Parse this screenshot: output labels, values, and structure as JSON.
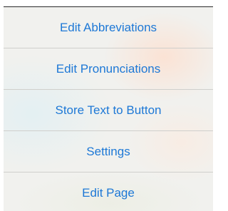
{
  "menu": {
    "items": [
      {
        "label": "Edit Abbreviations"
      },
      {
        "label": "Edit Pronunciations"
      },
      {
        "label": "Store Text to Button"
      },
      {
        "label": "Settings"
      },
      {
        "label": "Edit Page"
      }
    ]
  },
  "colors": {
    "accent": "#1d78d6",
    "separator": "#cfcfcc"
  }
}
